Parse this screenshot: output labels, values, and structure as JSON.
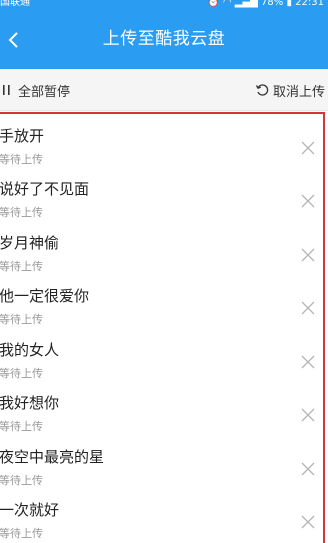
{
  "status_bar": {
    "carrier": "国联通",
    "battery": "78%",
    "time": "22:31"
  },
  "title_bar": {
    "title": "上传至酷我云盘"
  },
  "action_bar": {
    "pause_all_label": "全部暂停",
    "cancel_upload_label": "取消上传"
  },
  "uploads": [
    {
      "name": "手放开",
      "status": "等待上传"
    },
    {
      "name": "说好了不见面",
      "status": "等待上传"
    },
    {
      "name": "岁月神偷",
      "status": "等待上传"
    },
    {
      "name": "他一定很爱你",
      "status": "等待上传"
    },
    {
      "name": "我的女人",
      "status": "等待上传"
    },
    {
      "name": "我好想你",
      "status": "等待上传"
    },
    {
      "name": "夜空中最亮的星",
      "status": "等待上传"
    },
    {
      "name": "一次就好",
      "status": "等待上传"
    }
  ],
  "colors": {
    "brand_blue": "#2a9cf2",
    "highlight_red": "#d0383b"
  }
}
